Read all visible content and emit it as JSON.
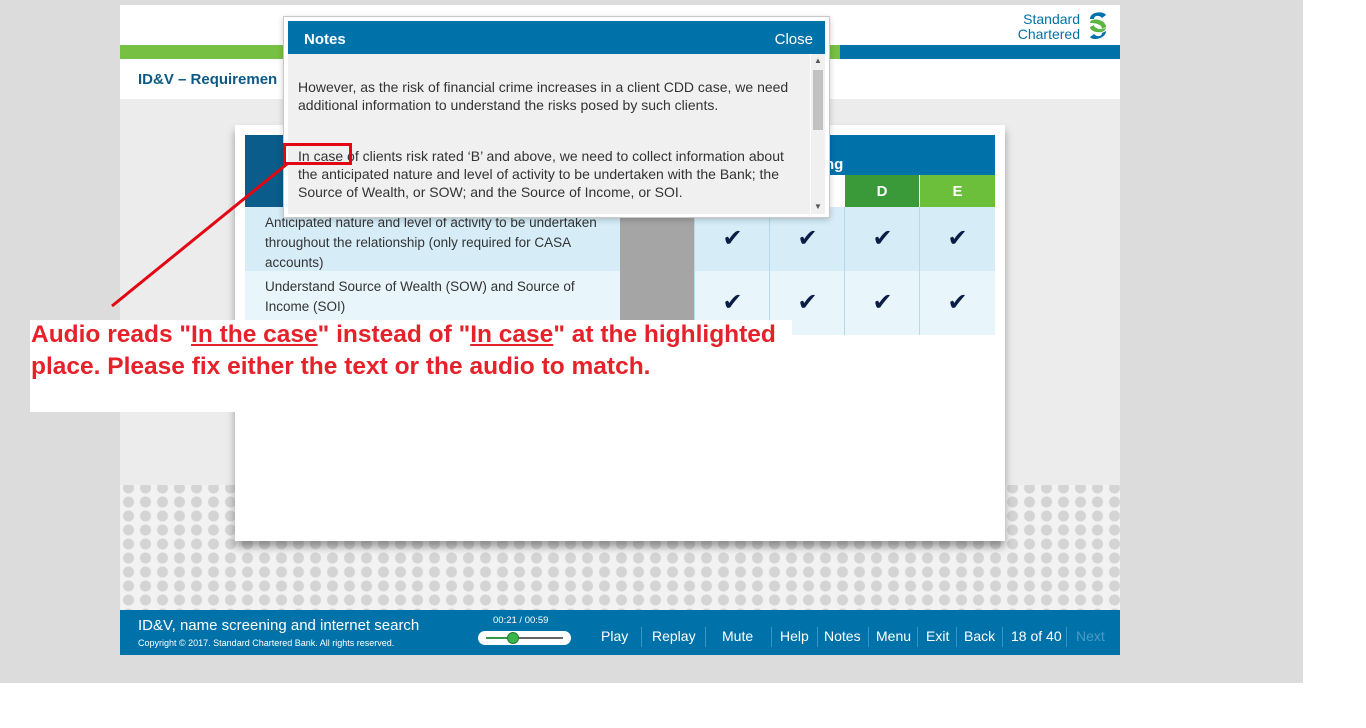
{
  "brand": {
    "line1": "Standard",
    "line2": "Chartered"
  },
  "page_title": "ID&V – Requiremen",
  "table": {
    "header_partial": "ng",
    "columns": [
      "D",
      "E"
    ],
    "column_colors": [
      "#3a9a3a",
      "#6bbf3a"
    ],
    "rows": [
      {
        "text": "Anticipated nature and level of activity to be undertaken throughout the relationship (only required for CASA accounts)"
      },
      {
        "text": "Understand Source of Wealth (SOW) and Source of Income (SOI)"
      }
    ],
    "check_glyph": "✔"
  },
  "notes": {
    "title": "Notes",
    "close_label": "Close",
    "paragraph1": "However, as the risk of financial crime increases in a client CDD case, we need additional information to understand the risks posed by such clients.",
    "paragraph2": "In case of clients risk rated ‘B’ and above, we need to collect information about the anticipated nature and level of activity to be undertaken with the Bank; the Source of Wealth, or SOW; and the Source of Income, or SOI."
  },
  "annotation": {
    "part1": "Audio reads \"",
    "term1": "In the case",
    "part2": "\" instead of \"",
    "term2": "In case",
    "part3": "\" at the highlighted place. Please fix either the text or the audio to match.",
    "color": "#e5212a"
  },
  "footer": {
    "course_title": "ID&V, name screening and internet search",
    "copyright": "Copyright © 2017. Standard Chartered Bank. All rights reserved.",
    "time": "00:21 / 00:59",
    "progress": 0.356,
    "nav": {
      "play": "Play",
      "replay": "Replay",
      "mute": "Mute",
      "help": "Help",
      "notes": "Notes",
      "menu": "Menu",
      "exit": "Exit",
      "back": "Back",
      "page_counter": "18 of 40",
      "next": "Next"
    }
  },
  "colors": {
    "primary": "#0072aa",
    "green": "#76c043",
    "annotation_red": "#e5212a"
  }
}
